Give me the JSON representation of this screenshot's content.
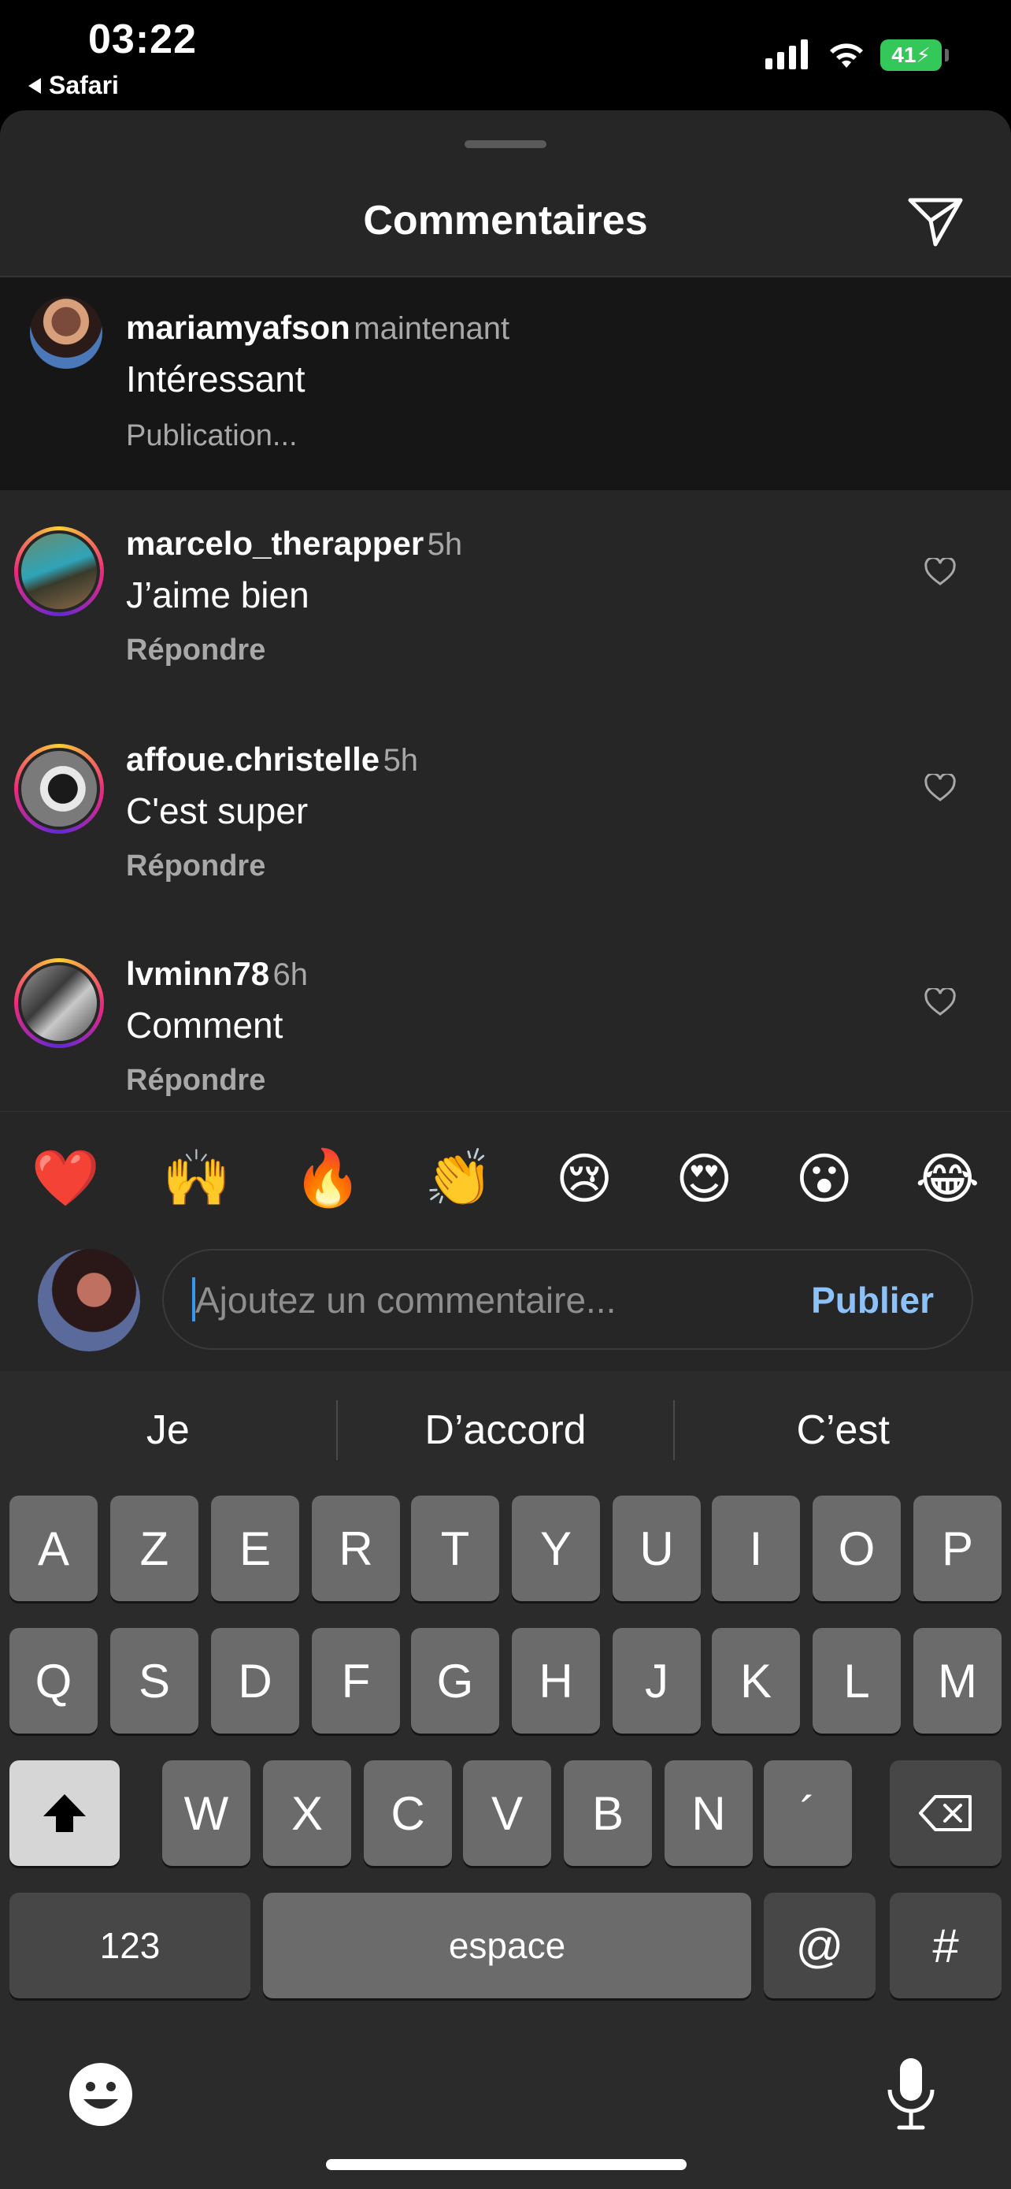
{
  "status": {
    "time": "03:22",
    "back_label": "Safari",
    "battery": "41"
  },
  "sheet": {
    "title": "Commentaires",
    "send_icon": "paper-plane-icon"
  },
  "pending_comment": {
    "username": "mariamyafson",
    "time": "maintenant",
    "text": "Intéressant",
    "status": "Publication..."
  },
  "comments": [
    {
      "username": "marcelo_therapper",
      "time": "5h",
      "text": "J’aime bien",
      "reply": "Répondre"
    },
    {
      "username": "affoue.christelle",
      "time": "5h",
      "text": "C'est super",
      "reply": "Répondre"
    },
    {
      "username": "lvminn78",
      "time": "6h",
      "text": "Comment",
      "reply": "Répondre"
    }
  ],
  "emojis": [
    "❤️",
    "🙌",
    "🔥",
    "👏",
    "😢",
    "😍",
    "😮",
    "😂"
  ],
  "composer": {
    "placeholder": "Ajoutez un commentaire...",
    "publish": "Publier"
  },
  "keyboard": {
    "suggestions": [
      "Je",
      "D’accord",
      "C’est"
    ],
    "row1": [
      "A",
      "Z",
      "E",
      "R",
      "T",
      "Y",
      "U",
      "I",
      "O",
      "P"
    ],
    "row2": [
      "Q",
      "S",
      "D",
      "F",
      "G",
      "H",
      "J",
      "K",
      "L",
      "M"
    ],
    "row3": [
      "W",
      "X",
      "C",
      "V",
      "B",
      "N",
      "´"
    ],
    "numbers": "123",
    "space": "espace",
    "at": "@",
    "hash": "#"
  }
}
